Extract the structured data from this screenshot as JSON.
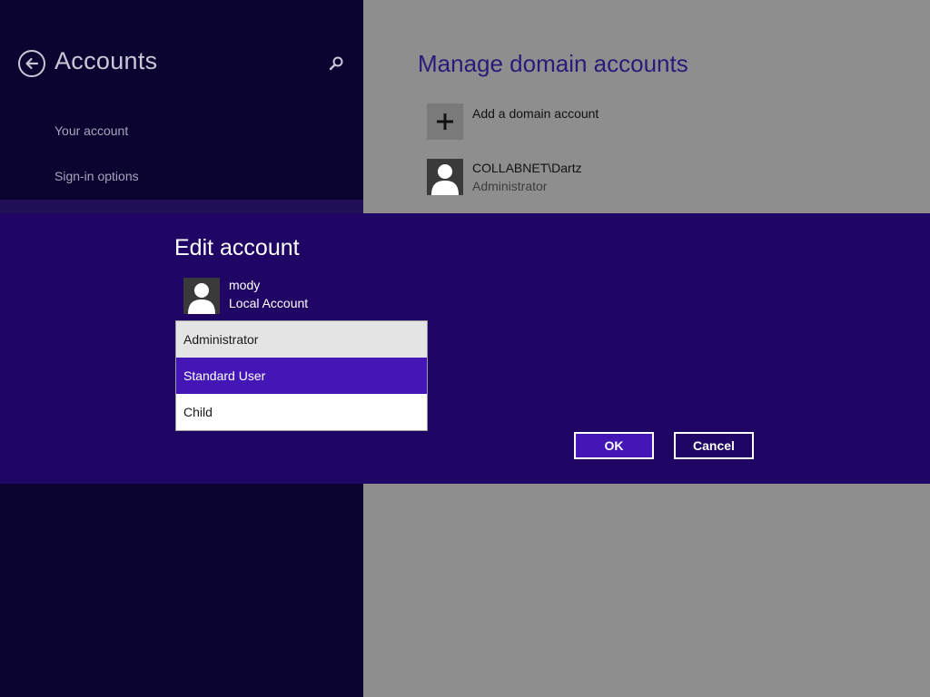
{
  "sidebar": {
    "title": "Accounts",
    "items": [
      {
        "label": "Your account"
      },
      {
        "label": "Sign-in options"
      }
    ]
  },
  "main": {
    "title": "Manage domain accounts",
    "add_account_label": "Add a domain account",
    "accounts": [
      {
        "name": "COLLABNET\\Dartz",
        "role": "Administrator"
      }
    ]
  },
  "dialog": {
    "title": "Edit account",
    "user_name": "mody",
    "user_type": "Local Account",
    "account_type_options": [
      {
        "label": "Administrator",
        "state": "hover"
      },
      {
        "label": "Standard User",
        "state": "selected"
      },
      {
        "label": "Child",
        "state": "normal"
      }
    ],
    "ok_label": "OK",
    "cancel_label": "Cancel"
  },
  "colors": {
    "sidebar_bg": "#0b0330",
    "dialog_bg": "#1f0664",
    "accent": "#4316b5",
    "main_bg": "#8e8e8e"
  },
  "icons": {
    "back": "back-arrow-icon",
    "search": "search-icon",
    "add": "plus-icon",
    "user": "user-avatar-icon"
  }
}
